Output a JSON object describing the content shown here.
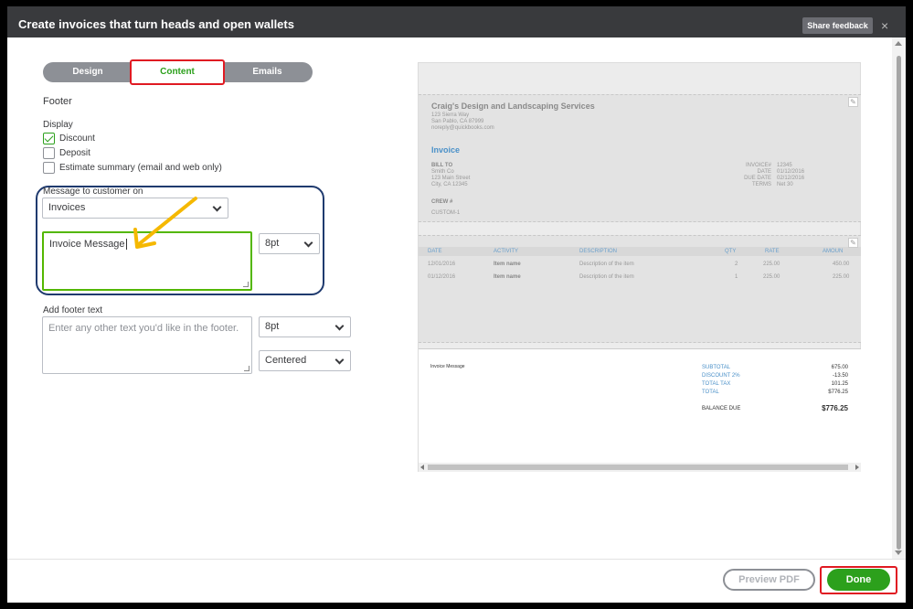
{
  "window": {
    "title": "Create invoices that turn heads and open wallets",
    "share_feedback": "Share feedback",
    "close": "×"
  },
  "tabs": [
    {
      "label": "Design"
    },
    {
      "label": "Content",
      "active": true
    },
    {
      "label": "Emails"
    }
  ],
  "footer_section": {
    "heading": "Footer",
    "display_label": "Display",
    "checkboxes": [
      {
        "label": "Discount",
        "checked": true
      },
      {
        "label": "Deposit",
        "checked": false
      },
      {
        "label": "Estimate summary (email and web only)",
        "checked": false
      }
    ],
    "message_label": "Message to customer on",
    "message_type": "Invoices",
    "message_value": "Invoice Message",
    "message_font_size": "8pt",
    "add_footer_label": "Add footer text",
    "footer_placeholder": "Enter any other text you'd like in the footer.",
    "footer_font_size": "8pt",
    "footer_alignment": "Centered"
  },
  "preview": {
    "company_name": "Craig's Design and Landscaping Services",
    "address1": "123 Sierra Way",
    "address2": "San Pablo, CA 87999",
    "email": "noreply@quickbooks.com",
    "doc_title": "Invoice",
    "bill_to_label": "BILL TO",
    "bill_to_lines": [
      "Smith Co",
      "123 Main Street",
      "City, CA 12345"
    ],
    "meta": [
      {
        "label": "INVOICE#",
        "value": "12345"
      },
      {
        "label": "DATE",
        "value": "01/12/2016"
      },
      {
        "label": "DUE DATE",
        "value": "02/12/2016"
      },
      {
        "label": "TERMS",
        "value": "Net 30"
      }
    ],
    "crew_label": "CREW #",
    "custom_label": "CUSTOM-1",
    "columns": [
      "DATE",
      "ACTIVITY",
      "DESCRIPTION",
      "QTY",
      "RATE",
      "AMOUN"
    ],
    "rows": [
      {
        "date": "12/01/2016",
        "activity": "Item name",
        "description": "Description of the item",
        "qty": "2",
        "rate": "225.00",
        "amount": "450.00"
      },
      {
        "date": "01/12/2016",
        "activity": "Item name",
        "description": "Description of the item",
        "qty": "1",
        "rate": "225.00",
        "amount": "225.00"
      }
    ],
    "message": "Invoice Message",
    "totals": [
      {
        "label": "SUBTOTAL",
        "value": "675.00"
      },
      {
        "label": "DISCOUNT 2%",
        "value": "-13.50"
      },
      {
        "label": "TOTAL TAX",
        "value": "101.25"
      },
      {
        "label": "TOTAL",
        "value": "$776.25"
      }
    ],
    "balance_due_label": "BALANCE DUE",
    "balance_due_value": "$776.25"
  },
  "actions": {
    "preview_pdf": "Preview PDF",
    "done": "Done"
  },
  "colors": {
    "accent_green": "#2ca01c",
    "highlight_red": "#e01a22",
    "callout_navy": "#1f3a6e",
    "arrow_yellow": "#f5b800",
    "titlebar": "#393a3d"
  }
}
